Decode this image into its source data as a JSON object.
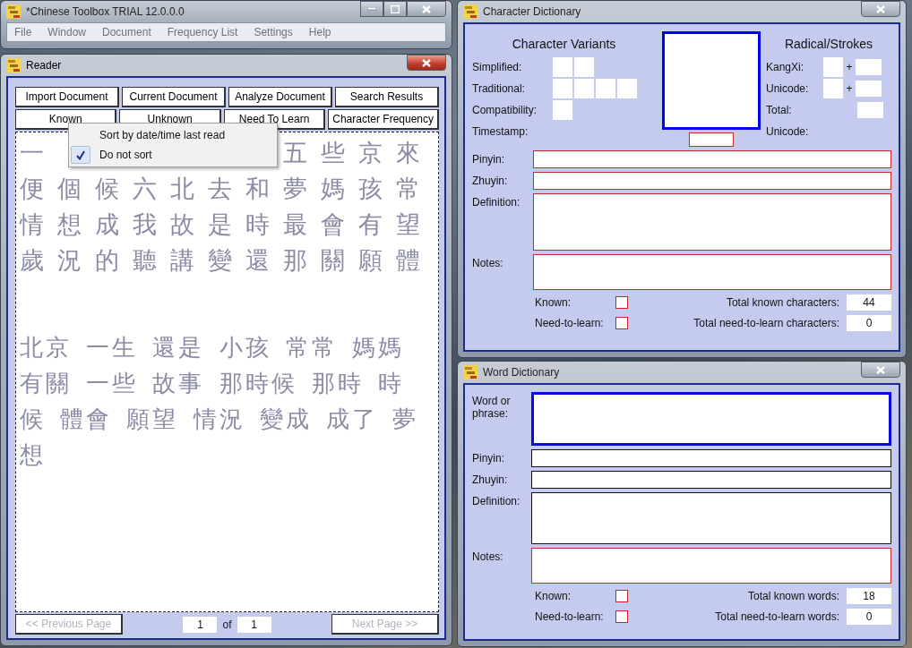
{
  "main_window": {
    "title": "*Chinese Toolbox TRIAL 12.0.0.0",
    "menu": [
      "File",
      "Window",
      "Document",
      "Frequency List",
      "Settings",
      "Help"
    ]
  },
  "reader": {
    "title": "Reader",
    "top_buttons": [
      "Import Document",
      "Current Document",
      "Analyze Document",
      "Search Results"
    ],
    "list_buttons": [
      "Known",
      "Unknown",
      "Need To Learn",
      "Character Frequency"
    ],
    "context_menu": [
      {
        "label": "Sort by date/time last read",
        "checked": false
      },
      {
        "label": "Do not sort",
        "checked": true
      }
    ],
    "character_rows": [
      {
        "cells": [
          "一"
        ],
        "after_menu": [
          "五",
          "些",
          "京",
          "來"
        ]
      },
      {
        "cells": [
          "便",
          "個",
          "候",
          "六",
          "北",
          "去",
          "和",
          "夢",
          "媽",
          "孩",
          "常"
        ]
      },
      {
        "cells": [
          "情",
          "想",
          "成",
          "我",
          "故",
          "是",
          "時",
          "最",
          "會",
          "有",
          "望"
        ]
      },
      {
        "cells": [
          "歲",
          "況",
          "的",
          "聽",
          "講",
          "變",
          "還",
          "那",
          "關",
          "願",
          "體"
        ]
      }
    ],
    "word_lines": [
      "北京 一生 還是 小孩 常常 媽媽",
      "有關 一些 故事 那時候 那時 時",
      "候 體會 願望 情況 變成 成了 夢",
      "想"
    ],
    "pager": {
      "previous": {
        "label": "<< Previous Page",
        "disabled": true
      },
      "page": "1",
      "of": "of",
      "total": "1",
      "next": {
        "label": "Next Page >>",
        "disabled": true
      }
    }
  },
  "character_dictionary": {
    "title": "Character Dictionary",
    "variants_heading": "Character Variants",
    "variant_rows": [
      "Simplified:",
      "Traditional:",
      "Compatibility:",
      "Timestamp:"
    ],
    "radical_heading": "Radical/Strokes",
    "radical_rows": [
      {
        "label": "KangXi:",
        "kind": "pair",
        "plus": "+"
      },
      {
        "label": "Unicode:",
        "kind": "pair",
        "plus": "+"
      },
      {
        "label": "Total:",
        "kind": "single"
      },
      {
        "label": "Unicode:",
        "kind": "none"
      }
    ],
    "fields": [
      {
        "label": "Pinyin:",
        "kind": "required_line"
      },
      {
        "label": "Zhuyin:",
        "kind": "required_line"
      },
      {
        "label": "Definition:",
        "kind": "required_area"
      },
      {
        "label": "Notes:",
        "kind": "required_short_area"
      }
    ],
    "checks": [
      {
        "label": "Known:",
        "checked": false
      },
      {
        "label": "Need-to-learn:",
        "checked": false
      }
    ],
    "totals": [
      {
        "label": "Total known characters:",
        "value": "44"
      },
      {
        "label": "Total need-to-learn characters:",
        "value": "0"
      }
    ]
  },
  "word_dictionary": {
    "title": "Word Dictionary",
    "fields": [
      {
        "label": "Word or phrase:",
        "kind": "focused_area"
      },
      {
        "label": "Pinyin:",
        "kind": "plain_line"
      },
      {
        "label": "Zhuyin:",
        "kind": "plain_line"
      },
      {
        "label": "Definition:",
        "kind": "plain_area"
      },
      {
        "label": "Notes:",
        "kind": "required_short_area"
      }
    ],
    "checks": [
      {
        "label": "Known:",
        "checked": false
      },
      {
        "label": "Need-to-learn:",
        "checked": false
      }
    ],
    "totals": [
      {
        "label": "Total known words:",
        "value": "18"
      },
      {
        "label": "Total need-to-learn words:",
        "value": "0"
      }
    ]
  }
}
